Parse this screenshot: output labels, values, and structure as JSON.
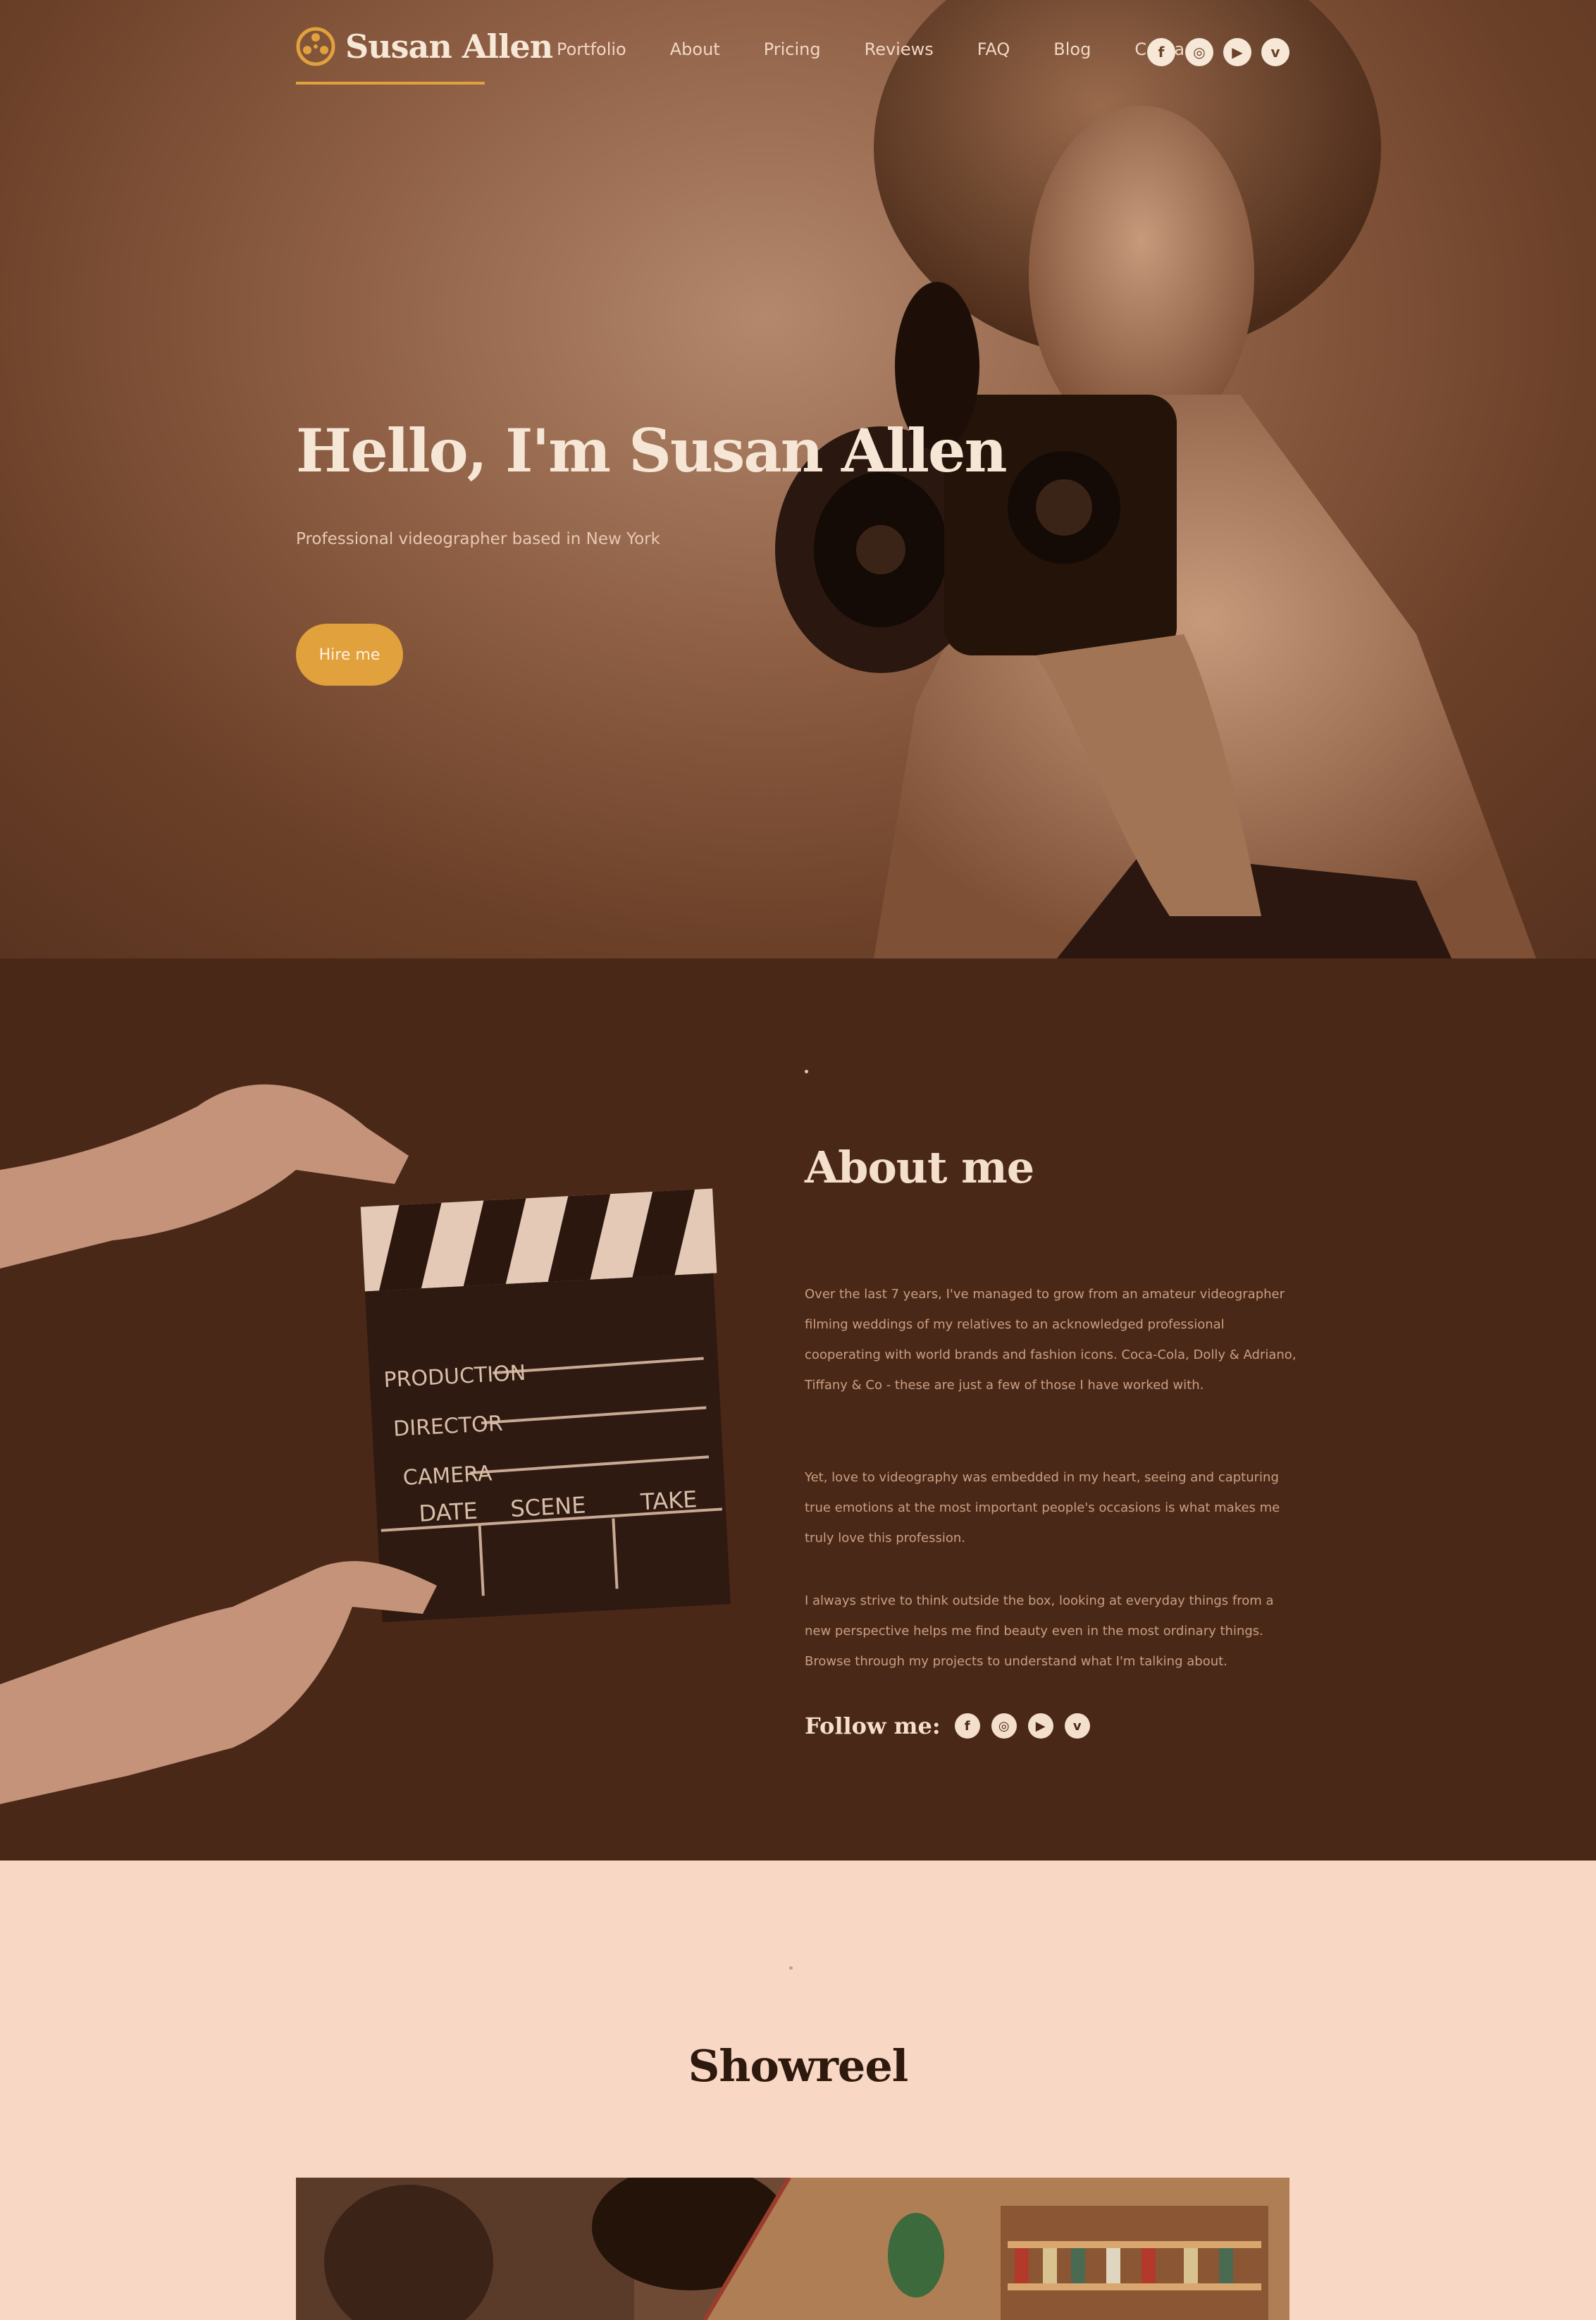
{
  "brand": {
    "name": "Susan Allen",
    "accent": "#e1a13c"
  },
  "nav": {
    "items": [
      "Portfolio",
      "About",
      "Pricing",
      "Reviews",
      "FAQ",
      "Blog",
      "Contacts"
    ],
    "social_icons": [
      "facebook-icon",
      "instagram-icon",
      "youtube-icon",
      "vimeo-icon"
    ]
  },
  "hero": {
    "title": "Hello, I'm Susan Allen",
    "subtitle": "Professional videographer based in New York",
    "button": "Hire me"
  },
  "about": {
    "title": "About me",
    "paragraphs": [
      "Over the last 7 years, I've managed to grow from an amateur videographer filming weddings of my relatives to an acknowledged professional cooperating with world brands and fashion icons. Coca-Cola, Dolly & Adriano, Tiffany & Co - these are just a few of those I have worked with.",
      "Yet, love to videography was embedded in my heart, seeing and capturing true emotions at the most important people's occasions is what makes me truly love this profession.",
      "I always strive to think outside the box, looking at everyday things from a new perspective helps me find beauty even in the most ordinary things. Browse through my projects to understand what I'm talking about."
    ],
    "follow_label": "Follow me:",
    "clapperboard": [
      "PRODUCTION",
      "DIRECTOR",
      "CAMERA",
      "DATE",
      "SCENE",
      "TAKE"
    ]
  },
  "showreel": {
    "title": "Showreel"
  }
}
